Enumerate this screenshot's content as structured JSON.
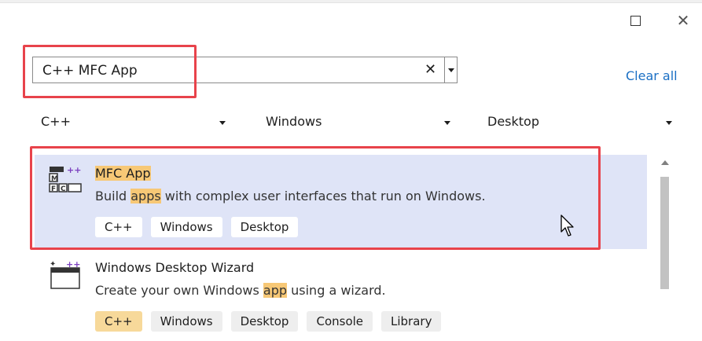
{
  "window": {
    "maximize_icon": "maximize-icon",
    "close_glyph": "✕"
  },
  "search": {
    "value": "C++ MFC App",
    "clear_glyph": "✕"
  },
  "clear_all_label": "Clear all",
  "filters": [
    {
      "value": "C++"
    },
    {
      "value": "Windows"
    },
    {
      "value": "Desktop"
    }
  ],
  "templates": [
    {
      "title": "MFC App",
      "desc_before": "Build ",
      "desc_highlight": "apps",
      "desc_after": " with complex user interfaces that run on Windows.",
      "icon": "mfc-app-icon",
      "tags": [
        "C++",
        "Windows",
        "Desktop"
      ]
    },
    {
      "title": "Windows Desktop Wizard",
      "desc_before": "Create your own Windows ",
      "desc_highlight": "app",
      "desc_after": " using a wizard.",
      "icon": "windows-desktop-wizard-icon",
      "tags": [
        "C++",
        "Windows",
        "Desktop",
        "Console",
        "Library"
      ]
    }
  ],
  "colors": {
    "highlight": "#f7c876",
    "selection": "#dfe4f7",
    "callout": "#e8434b",
    "link": "#1a6fc4"
  }
}
